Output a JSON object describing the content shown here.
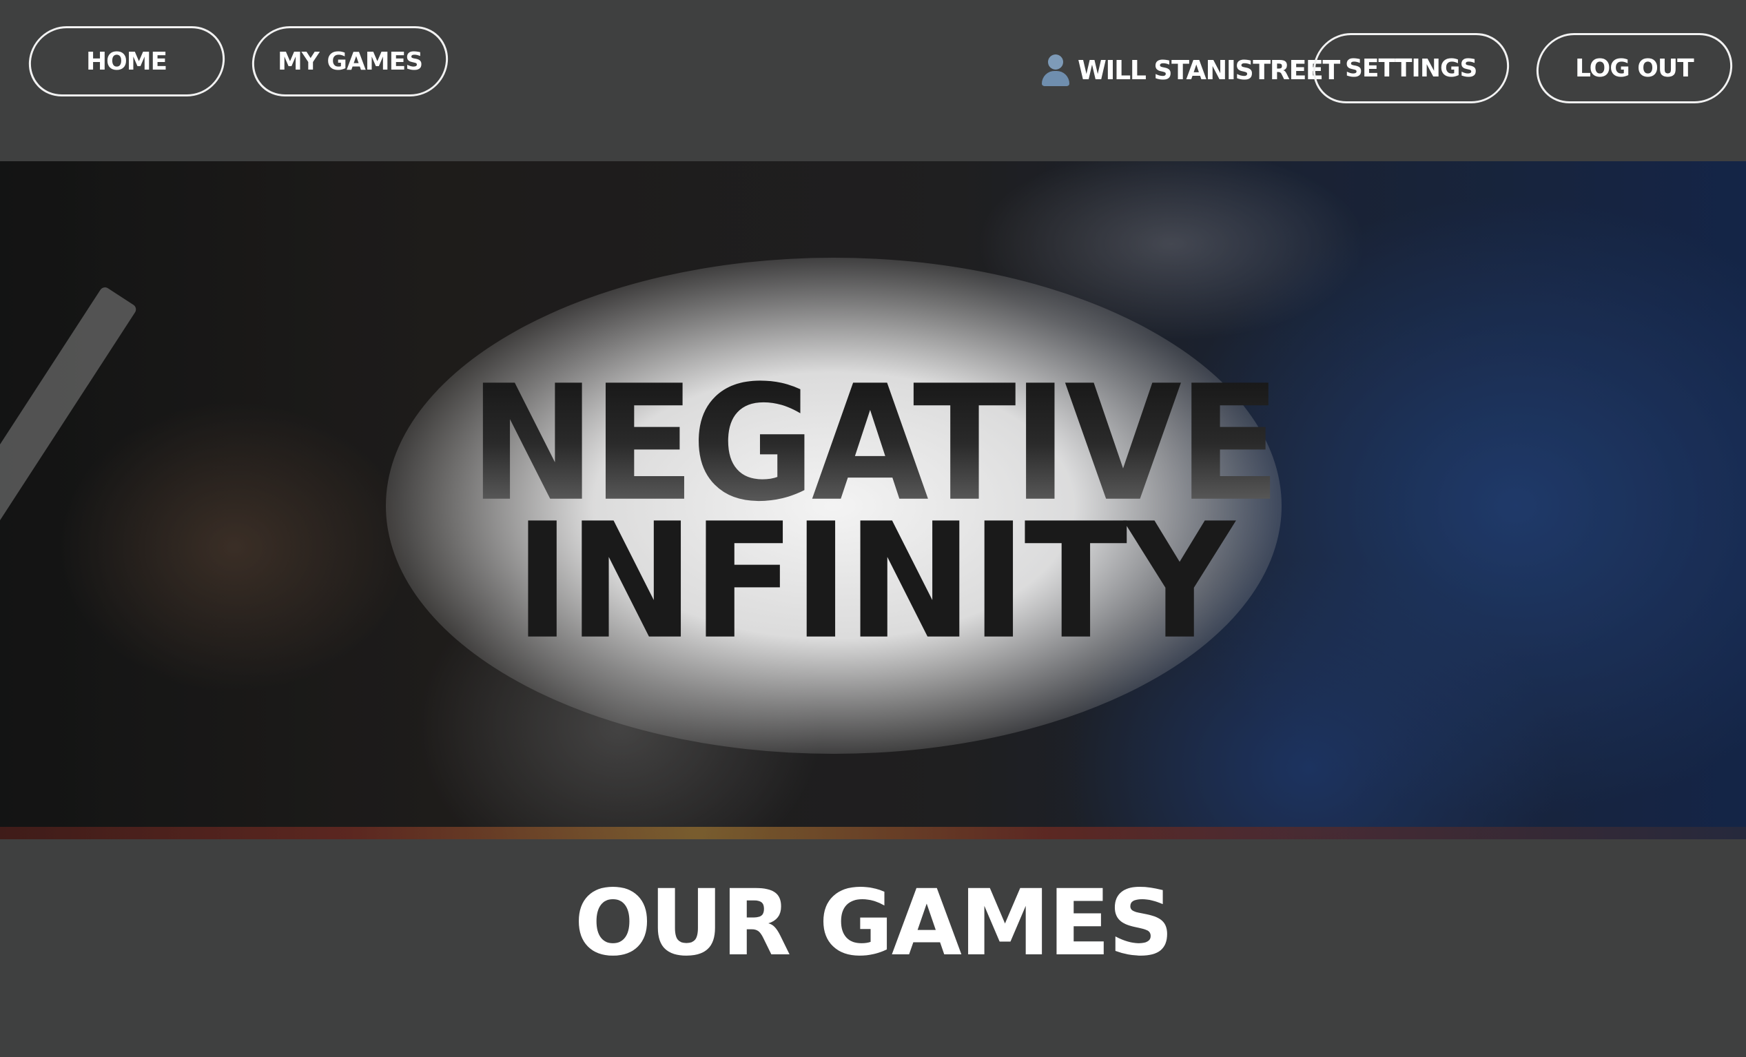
{
  "nav": {
    "home_label": "HOME",
    "my_games_label": "MY GAMES",
    "user_icon": "user-silhouette-icon",
    "user_name": "WILL STANISTREET",
    "settings_label": "SETTINGS",
    "logout_label": "LOG OUT"
  },
  "hero": {
    "title_line1": "NEGATIVE",
    "title_line2": "INFINITY"
  },
  "section": {
    "title": "OUR GAMES"
  },
  "colors": {
    "background": "#3f4040",
    "button_border": "#f2f2f2",
    "text": "#ffffff",
    "hero_title": "#1a1a1a"
  }
}
